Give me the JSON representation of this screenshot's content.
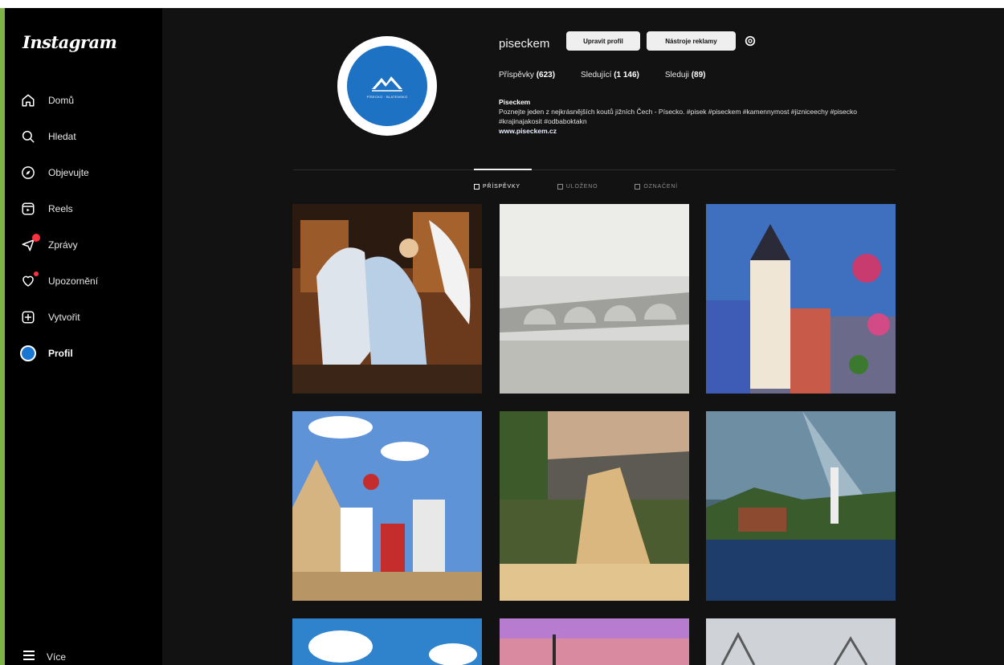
{
  "app": {
    "logo": "Instagram"
  },
  "sidebar": {
    "items": [
      {
        "label": "Domů",
        "icon": "home-icon"
      },
      {
        "label": "Hledat",
        "icon": "search-icon"
      },
      {
        "label": "Objevujte",
        "icon": "compass-icon"
      },
      {
        "label": "Reels",
        "icon": "reels-icon"
      },
      {
        "label": "Zprávy",
        "icon": "messenger-icon",
        "badge": true
      },
      {
        "label": "Upozornění",
        "icon": "heart-icon",
        "badge": true
      },
      {
        "label": "Vytvořit",
        "icon": "create-icon"
      },
      {
        "label": "Profil",
        "icon": "avatar-icon",
        "active": true
      }
    ],
    "more_label": "Více"
  },
  "profile": {
    "username": "piseckem",
    "edit_button": "Upravit profil",
    "ads_button": "Nástroje reklamy",
    "stats": {
      "posts_label": "Příspěvky",
      "posts_value": "(623)",
      "followers_label": "Sledující",
      "followers_value": "(1 146)",
      "following_label": "Sleduji",
      "following_value": "(89)"
    },
    "bio": {
      "name": "Piseckem",
      "text": "Poznejte jeden z nejkrásnějších koutů jižních Čech - Písecko. #pisek #piseckem #kamennymost #jizniceechy #pisecko #krajinajakosit #odbaboktakn",
      "link": "www.piseckem.cz"
    },
    "avatar_text": "PÍSECKO · BLATENSKO"
  },
  "tabs": [
    {
      "label": "PŘÍSPĚVKY",
      "active": true
    },
    {
      "label": "ULOŽENO",
      "active": false
    },
    {
      "label": "OZNAČENÍ",
      "active": false
    }
  ],
  "colors": {
    "background": "#121212",
    "sidebar": "#000000",
    "accent_blue": "#1d72c4",
    "badge_red": "#ff3040",
    "window_border": "#7db347"
  }
}
